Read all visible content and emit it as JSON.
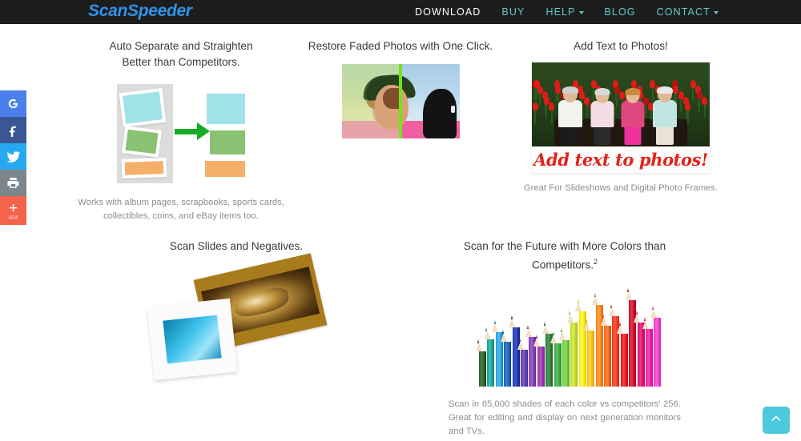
{
  "header": {
    "logo": "ScanSpeeder",
    "nav": [
      {
        "label": "DOWNLOAD",
        "active": true,
        "caret": false
      },
      {
        "label": "BUY",
        "active": false,
        "caret": false
      },
      {
        "label": "HELP",
        "active": false,
        "caret": true
      },
      {
        "label": "BLOG",
        "active": false,
        "caret": false
      },
      {
        "label": "CONTACT",
        "active": false,
        "caret": true
      }
    ],
    "colors": {
      "bar": "#1d1d1d",
      "logo": "#2e93e8",
      "link": "#5fcbc7",
      "active": "#ffffff"
    }
  },
  "social_sidebar": {
    "items": [
      {
        "icon": "google-icon",
        "name": "Google",
        "color": "#4a7fec",
        "count": ""
      },
      {
        "icon": "facebook-icon",
        "name": "Facebook",
        "color": "#3a5795",
        "count": ""
      },
      {
        "icon": "twitter-icon",
        "name": "Twitter",
        "color": "#26a9f0",
        "count": ""
      },
      {
        "icon": "print-icon",
        "name": "Print",
        "color": "#7d868c",
        "count": ""
      },
      {
        "icon": "plus-icon",
        "name": "More",
        "color": "#f4644d",
        "count": "404"
      }
    ],
    "more_count": "404",
    "plus_glyph": "+"
  },
  "features": {
    "auto_separate": {
      "title_line1": "Auto Separate and Straighten",
      "title_line2": "Better than Competitors.",
      "caption_line1": "Works with album pages, scrapbooks, sports cards,",
      "caption_line2": "collectibles, coins, and eBay items too.",
      "photo_colors": [
        "#9fe2e8",
        "#88c272",
        "#f4b06a"
      ],
      "arrow_color": "#15ac26",
      "scanpage_color": "#dcdcdc"
    },
    "restore_faded": {
      "title": "Restore Faded Photos with One Click.",
      "split_color": "#72e31b",
      "faded_side": "left",
      "restored_side": "right"
    },
    "add_text": {
      "title": "Add Text to Photos!",
      "overlay_text": "Add text to photos!",
      "overlay_color": "#e2231a",
      "caption": "Great For Slideshows and Digital Photo Frames."
    },
    "slides": {
      "title": "Scan Slides and Negatives.",
      "film_color": "#a87b1c",
      "slide_color": "#3fc4ee"
    },
    "colors": {
      "title_line1": "Scan for the Future with More Colors than",
      "title_line2": "Competitors.",
      "title_superscript": "2",
      "caption": "Scan in 65,000 shades of each color vs competitors' 256. Great for editing and display on next generation monitors and TVs.",
      "pencil_colors": [
        "#2f5f2a",
        "#1e9e8f",
        "#2f9fd4",
        "#1e5fb8",
        "#2237a8",
        "#5b3fa8",
        "#7d3fb0",
        "#9b35a8",
        "#2f7d3a",
        "#3fa33f",
        "#6fc23f",
        "#bcd22f",
        "#f2e31b",
        "#f7b81b",
        "#f58220",
        "#f2651b",
        "#ed3b24",
        "#e01b24",
        "#c41230",
        "#d4176b",
        "#e3239b",
        "#ef3fc0"
      ],
      "pencil_heights": [
        60,
        75,
        84,
        72,
        90,
        62,
        78,
        66,
        82,
        70,
        74,
        96,
        110,
        86,
        118,
        92,
        104,
        82,
        124,
        96,
        88,
        102
      ]
    }
  },
  "scroll_top": {
    "name": "scroll-to-top",
    "glyph": "chevron-up",
    "color": "#4ec8dc"
  }
}
